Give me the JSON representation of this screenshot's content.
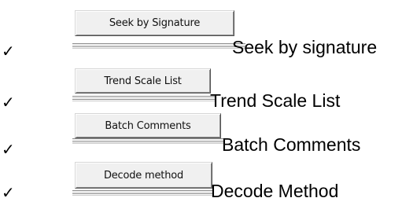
{
  "check_glyph": "✓",
  "items": [
    {
      "button_label": "Seek by Signature",
      "description": "Seek by signature"
    },
    {
      "button_label": "Trend Scale List",
      "description": "Trend Scale List"
    },
    {
      "button_label": "Batch Comments",
      "description": "Batch Comments"
    },
    {
      "button_label": "Decode method",
      "description": "Decode Method"
    }
  ]
}
